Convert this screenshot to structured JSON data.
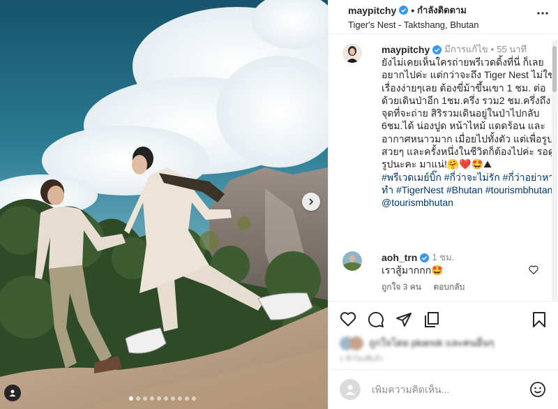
{
  "post": {
    "username": "maypitchy",
    "follow_status": "กำลังติดตาม",
    "location": "Tiger's Nest - Taktshang, Bhutan"
  },
  "caption": {
    "username": "maypitchy",
    "edited": "มีการแก้ไข",
    "time": "55 นาที",
    "text": "ยังไม่เคยเห็นใครถ่ายพรีเวดดิ้งที่นี่ ก็เลยอยากไปค่ะ แต่กว่าจะถึง Tiger Nest ไม่ใช่เรื่องง่ายๆเลย ต้องขี่ม้าขึ้นเขา 1 ชม. ต่อด้วยเดินป่าอีก 1ชม.ครึ่ง รวม2 ชม.ครึ่งถึงจุดที่จะถ่าย สิริรวมเดินอยู่ในป่าไปกลับ 6ชม.ได้ น่องปูด หน้าไหม้ แดดร้อน และอากาศหนาวมาก เมื่อยไปทั้งตัว แต่เพื่อรูปสวยๆ และครั้งหนึ่งในชีวิตก็ต้องไปค่ะ รอดูรูปนะคะ มาแน่!🤗❤️🤩⛰",
    "hashtags": [
      "#พรีเวดเมย์บิ๊ก",
      "#กี่ว่าจะไม่รัก",
      "#กี่ว่าอย่าหาทำ",
      "#TigerNest",
      "#Bhutan",
      "#tourismbhutan",
      "@tourismbhutan"
    ]
  },
  "comment": {
    "username": "aoh_trn",
    "time": "1 ชม.",
    "text": "เราสู้มากกก🤩",
    "likes": "ถูกใจ 3 คน",
    "reply": "ตอบกลับ"
  },
  "likes_section": {
    "liked_by": "ถูกใจโดย pkanok และคนอื่นๆ",
    "time": "1 ชั่วโมงที่แล้ว"
  },
  "add_comment": {
    "placeholder": "เพิ่มความคิดเห็น..."
  },
  "carousel": {
    "slide_count": 10,
    "active_index": 0
  },
  "colors": {
    "verified": "#3897f0",
    "link": "#00376b",
    "meta": "#8e8e8e"
  }
}
